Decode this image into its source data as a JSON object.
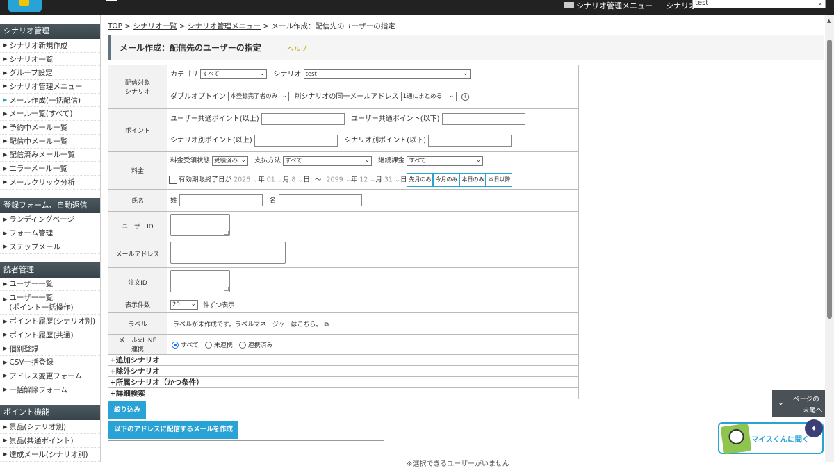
{
  "topbar": {
    "menu_label": "シナリオ管理メニュー",
    "scenario_label": "シナリオ",
    "scenario_value": "test"
  },
  "sidebar": {
    "sections": [
      {
        "title": "シナリオ管理",
        "items": [
          "シナリオ新規作成",
          "シナリオ一覧",
          "グループ設定",
          "シナリオ管理メニュー",
          "メール作成(一括配信)",
          "メール一覧(すべて)",
          "予約中メール一覧",
          "配信中メール一覧",
          "配信済みメール一覧",
          "エラーメール一覧",
          "メールクリック分析"
        ]
      },
      {
        "title": "登録フォーム、自動返信",
        "items": [
          "ランディングページ",
          "フォーム管理",
          "ステップメール"
        ]
      },
      {
        "title": "読者管理",
        "items": [
          "ユーザー一覧",
          "ユーザー一覧\n(ポイント一括操作)",
          "ポイント履歴(シナリオ別)",
          "ポイント履歴(共通)",
          "個別登録",
          "CSV一括登録",
          "アドレス変更フォーム",
          "一括解除フォーム"
        ]
      },
      {
        "title": "ポイント機能",
        "items": [
          "景品(シナリオ別)",
          "景品(共通ポイント)",
          "達成メール(シナリオ別)"
        ]
      }
    ]
  },
  "breadcrumb": {
    "top": "TOP",
    "list": "シナリオ一覧",
    "menu": "シナリオ管理メニュー",
    "current": "メール作成：配信先のユーザーの指定",
    "sep": ">"
  },
  "page_title": "メール作成：配信先のユーザーの指定",
  "help_label": "ヘルプ",
  "form": {
    "target": {
      "label1": "配信対象",
      "label2": "シナリオ",
      "category_label": "カテゴリ",
      "category_value": "すべて",
      "scenario_label": "シナリオ",
      "scenario_value": "test",
      "double_optin_label": "ダブルオプトイン",
      "double_optin_value": "本登録完了者のみ",
      "same_email_label": "別シナリオの同一メールアドレス",
      "same_email_value": "1通にまとめる"
    },
    "point": {
      "label": "ポイント",
      "common_min": "ユーザー共通ポイント(以上)",
      "common_max": "ユーザー共通ポイント(以下)",
      "scenario_min": "シナリオ別ポイント(以上)",
      "scenario_max": "シナリオ別ポイント(以下)"
    },
    "fee": {
      "label": "料金",
      "status_label": "料金受領状態",
      "status_value": "受領済み",
      "method_label": "支払方法",
      "method_value": "すべて",
      "recurring_label": "継続課金",
      "recurring_value": "すべて",
      "expiry_label": "有効期限終了日が",
      "from_year": "2026",
      "from_month": "01",
      "from_day": "8",
      "to_year": "2099",
      "to_month": "12",
      "to_day": "31",
      "year": "年",
      "month": "月",
      "day": "日",
      "tilde": "～",
      "btn_last_month": "先月のみ",
      "btn_this_month": "今月のみ",
      "btn_today": "本日のみ",
      "btn_after_today": "本日以降"
    },
    "name": {
      "label": "氏名",
      "last": "姓",
      "first": "名"
    },
    "user_id": {
      "label": "ユーザーID"
    },
    "email": {
      "label": "メールアドレス"
    },
    "order_id": {
      "label": "注文ID"
    },
    "display": {
      "label": "表示件数",
      "value": "20",
      "suffix": "件ずつ表示"
    },
    "labels": {
      "label": "ラベル",
      "text": "ラベルが未作成です。ラベルマネージャーはこちら。"
    },
    "line": {
      "label1": "メール×LINE",
      "label2": "連携",
      "opt_all": "すべて",
      "opt_none": "未連携",
      "opt_linked": "連携済み"
    },
    "expand": [
      "+追加シナリオ",
      "+除外シナリオ",
      "+所属シナリオ（かつ条件）",
      "+詳細検索"
    ]
  },
  "buttons": {
    "filter": "絞り込み",
    "create": "以下のアドレスに配信するメールを作成"
  },
  "bottom_note": "※選択できるユーザーがいません",
  "page_end": {
    "line1": "ページの",
    "line2": "末尾へ"
  },
  "assistant": {
    "label": "マイスくんに聞く"
  },
  "colors": {
    "accent": "#29a3d6",
    "sidebar_head": "#3e4a50",
    "help": "#c8a000"
  }
}
